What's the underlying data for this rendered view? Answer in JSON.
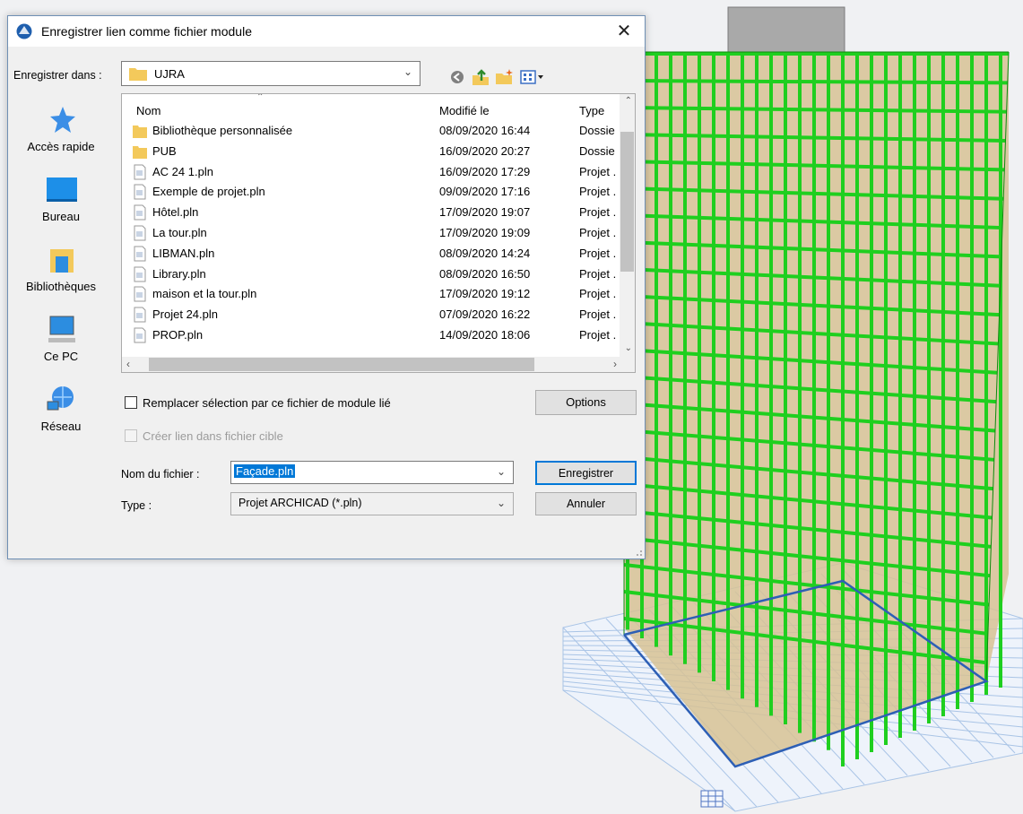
{
  "dialog": {
    "title": "Enregistrer lien comme fichier module",
    "close_glyph": "✕",
    "lookin_label": "Enregistrer dans :",
    "lookin_value": "UJRA",
    "toolbar_icons": [
      "back-icon",
      "up-folder-icon",
      "new-folder-icon",
      "view-menu-icon"
    ],
    "places": [
      {
        "label": "Accès rapide",
        "icon": "star-icon"
      },
      {
        "label": "Bureau",
        "icon": "desktop-icon"
      },
      {
        "label": "Bibliothèques",
        "icon": "libraries-icon"
      },
      {
        "label": "Ce PC",
        "icon": "computer-icon"
      },
      {
        "label": "Réseau",
        "icon": "network-icon"
      }
    ],
    "columns": {
      "name": "Nom",
      "modified": "Modifié le",
      "type": "Type"
    },
    "files": [
      {
        "name": "Bibliothèque personnalisée",
        "modified": "08/09/2020 16:44",
        "type": "Dossie",
        "kind": "folder"
      },
      {
        "name": "PUB",
        "modified": "16/09/2020 20:27",
        "type": "Dossie",
        "kind": "folder"
      },
      {
        "name": "AC 24 1.pln",
        "modified": "16/09/2020 17:29",
        "type": "Projet .",
        "kind": "file"
      },
      {
        "name": "Exemple de projet.pln",
        "modified": "09/09/2020 17:16",
        "type": "Projet .",
        "kind": "file"
      },
      {
        "name": "Hôtel.pln",
        "modified": "17/09/2020 19:07",
        "type": "Projet .",
        "kind": "file"
      },
      {
        "name": "La tour.pln",
        "modified": "17/09/2020 19:09",
        "type": "Projet .",
        "kind": "file"
      },
      {
        "name": "LIBMAN.pln",
        "modified": "08/09/2020 14:24",
        "type": "Projet .",
        "kind": "file"
      },
      {
        "name": "Library.pln",
        "modified": "08/09/2020 16:50",
        "type": "Projet .",
        "kind": "file"
      },
      {
        "name": "maison et la tour.pln",
        "modified": "17/09/2020 19:12",
        "type": "Projet .",
        "kind": "file"
      },
      {
        "name": "Projet 24.pln",
        "modified": "07/09/2020 16:22",
        "type": "Projet .",
        "kind": "file"
      },
      {
        "name": "PROP.pln",
        "modified": "14/09/2020 18:06",
        "type": "Projet .",
        "kind": "file"
      }
    ],
    "replace_checkbox": {
      "label": "Remplacer sélection par ce fichier de module lié",
      "checked": false
    },
    "createlink_checkbox": {
      "label": "Créer lien dans fichier cible",
      "checked": false,
      "disabled": true
    },
    "options_button": "Options",
    "filename_label": "Nom du fichier :",
    "filename_value": "Façade.pln",
    "type_label": "Type :",
    "type_value": "Projet ARCHICAD (*.pln)",
    "save_button": "Enregistrer",
    "cancel_button": "Annuler"
  },
  "colors": {
    "accent": "#0078d7",
    "mesh_green": "#1fcf1f",
    "floor_tan": "#c8a46a",
    "grid_blue": "#a9c4e6"
  }
}
